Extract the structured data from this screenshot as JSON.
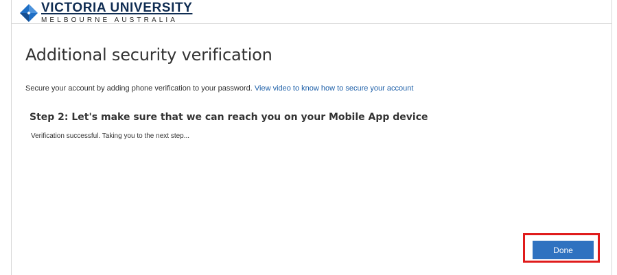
{
  "header": {
    "logo_name": "VICTORIA UNIVERSITY",
    "logo_subtitle": "MELBOURNE AUSTRALIA",
    "logo_icon": "victoria-university-diamond-icon",
    "brand_colors": {
      "navy": "#0f2c52",
      "blue": "#1f6fc5"
    }
  },
  "main": {
    "title": "Additional security verification",
    "intro_text": "Secure your account by adding phone verification to your password.",
    "intro_link": "View video to know how to secure your account",
    "step_heading": "Step 2: Let's make sure that we can reach you on your Mobile App device",
    "status_text": "Verification successful. Taking you to the next step..."
  },
  "actions": {
    "done_label": "Done",
    "button_color": "#2f72c0",
    "highlight_color": "#e01b1b"
  }
}
